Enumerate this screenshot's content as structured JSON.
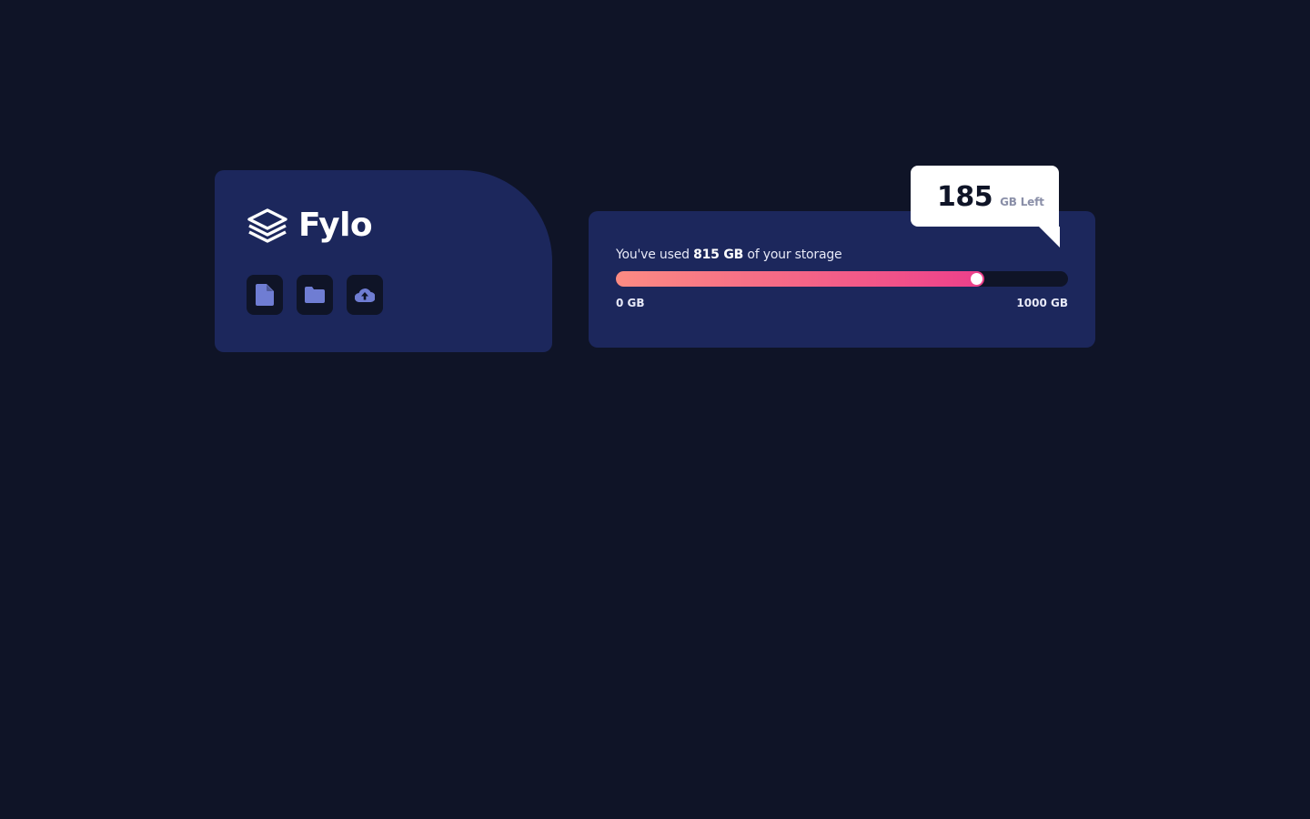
{
  "brand": {
    "name": "Fylo",
    "actions": [
      {
        "icon": "document-icon"
      },
      {
        "icon": "folder-icon"
      },
      {
        "icon": "cloud-upload-icon"
      }
    ]
  },
  "storage": {
    "usage_prefix": "You've used",
    "used_amount": "815 GB",
    "usage_suffix": "of your storage",
    "min_label": "0 GB",
    "max_label": "1000 GB",
    "used_fraction": 0.815
  },
  "callout": {
    "value": "185",
    "unit": "GB Left"
  },
  "colors": {
    "background": "#0f1427",
    "card": "#1c275c",
    "icon": "#6f7dd3",
    "gradient_start": "#fc8b83",
    "gradient_end": "#ec3f8b"
  }
}
